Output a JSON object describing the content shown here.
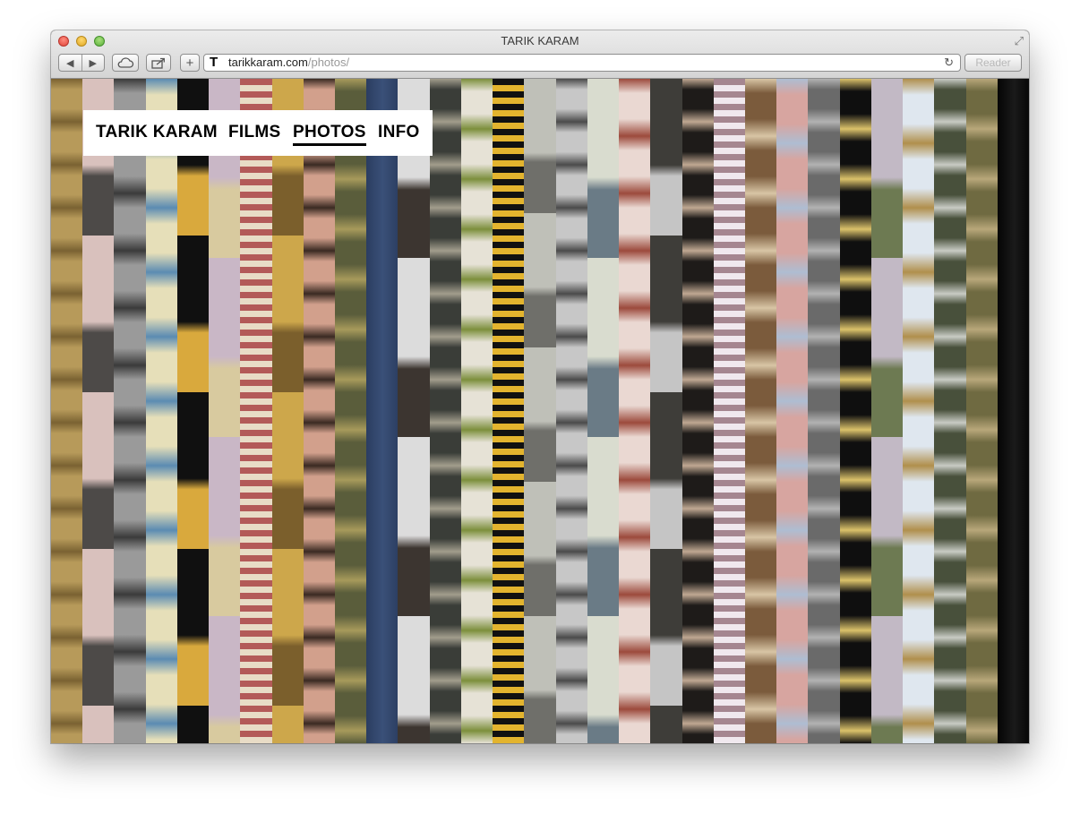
{
  "window": {
    "title": "TARIK KARAM",
    "url_domain": "tarikkaram.com",
    "url_path": "/photos/",
    "reader_label": "Reader",
    "favicon_letter": "T"
  },
  "toolbar": {
    "back_icon": "◀",
    "forward_icon": "▶",
    "plus_icon": "+",
    "reload_icon": "↻",
    "fullscreen_icon": "⤢"
  },
  "nav": {
    "brand": "TARIK KARAM",
    "films": "FILMS",
    "photos": "PHOTOS",
    "info": "INFO",
    "active": "PHOTOS"
  },
  "gallery": {
    "strips": [
      {
        "name": "strip-faces-gold",
        "a": "#b79a5a",
        "b": "#7a6232",
        "p": "rep"
      },
      {
        "name": "strip-walkers-pink",
        "a": "#d9c1bd",
        "b": "#4d4a48",
        "p": "blk"
      },
      {
        "name": "strip-bw-hand",
        "a": "#9a9a9a",
        "b": "#3b3b3b",
        "p": "rep"
      },
      {
        "name": "strip-map-cream",
        "a": "#e6dfb9",
        "b": "#5b8bb2",
        "p": "rep"
      },
      {
        "name": "strip-market-black",
        "a": "#101010",
        "b": "#d9a93d",
        "p": "blk"
      },
      {
        "name": "strip-lilac-blur",
        "a": "#c9b7c6",
        "b": "#d8ca9f",
        "p": "blk"
      },
      {
        "name": "strip-red-cream-stripes",
        "a": "#b35a58",
        "b": "#e8dcc6",
        "p": "stripe"
      },
      {
        "name": "strip-golden-tree",
        "a": "#cda74b",
        "b": "#7b5f2c",
        "p": "blk"
      },
      {
        "name": "strip-man-face",
        "a": "#d2a08c",
        "b": "#3a2a22",
        "p": "rep"
      },
      {
        "name": "strip-green-olive",
        "a": "#5a5d3b",
        "b": "#a79a5b",
        "p": "rep"
      },
      {
        "name": "strip-navy-blue",
        "a": "#2b3d61",
        "b": "#3a5078",
        "p": "solid"
      },
      {
        "name": "strip-house-grey",
        "a": "#dcdcdc",
        "b": "#3c3530",
        "p": "blk"
      },
      {
        "name": "strip-ofrah-chalk",
        "a": "#3a3d38",
        "b": "#a29d8c",
        "p": "rep"
      },
      {
        "name": "strip-woman-hat",
        "a": "#e6e2d6",
        "b": "#7c8f3c",
        "p": "rep"
      },
      {
        "name": "strip-yellow-lines",
        "a": "#111111",
        "b": "#e3b42e",
        "p": "stripe"
      },
      {
        "name": "strip-blur-portrait",
        "a": "#bfc0b8",
        "b": "#6f6f6a",
        "p": "blk"
      },
      {
        "name": "strip-letter-d",
        "a": "#c7c7c7",
        "b": "#4b4b4b",
        "p": "rep"
      },
      {
        "name": "strip-winter-water",
        "a": "#d9dccf",
        "b": "#6a7b86",
        "p": "blk"
      },
      {
        "name": "strip-hand-pink",
        "a": "#ead8d2",
        "b": "#9c4a3c",
        "p": "rep"
      },
      {
        "name": "strip-fog-grey",
        "a": "#3e3d39",
        "b": "#c5c5c5",
        "p": "blk"
      },
      {
        "name": "strip-man-cigarette",
        "a": "#1e1b19",
        "b": "#c0a892",
        "p": "rep"
      },
      {
        "name": "strip-pattern-pink",
        "a": "#a58690",
        "b": "#f0e8ee",
        "p": "stripe"
      },
      {
        "name": "strip-brown-dots",
        "a": "#7b5b3c",
        "b": "#d8c5a5",
        "p": "rep"
      },
      {
        "name": "strip-lips-blue",
        "a": "#d7a5a0",
        "b": "#aebdd2",
        "p": "rep"
      },
      {
        "name": "strip-grey-dots",
        "a": "#6a6a6a",
        "b": "#b2b2b2",
        "p": "rep"
      },
      {
        "name": "strip-yellow-black",
        "a": "#0f0f0f",
        "b": "#dbc26a",
        "p": "rep"
      },
      {
        "name": "strip-green-field",
        "a": "#c2b9c5",
        "b": "#6d7a52",
        "p": "blk"
      },
      {
        "name": "strip-sky-figure",
        "a": "#dfe7ef",
        "b": "#b08f4c",
        "p": "rep"
      },
      {
        "name": "strip-bokeh-lights",
        "a": "#48503b",
        "b": "#c8cbc4",
        "p": "rep"
      },
      {
        "name": "strip-old-man",
        "a": "#6f6a41",
        "b": "#b8a77a",
        "p": "rep"
      },
      {
        "name": "strip-black-edge",
        "a": "#050505",
        "b": "#1a1a1a",
        "p": "solid"
      }
    ]
  }
}
